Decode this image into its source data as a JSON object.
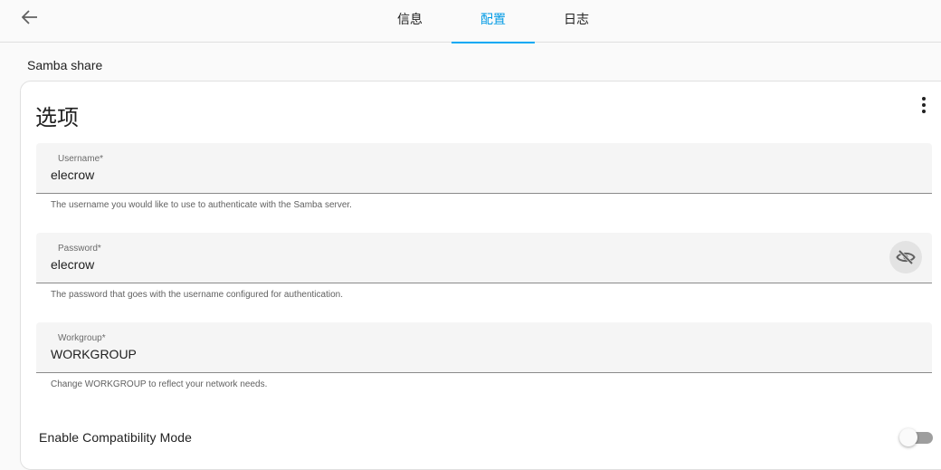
{
  "header": {
    "back_icon": "arrow-left-icon",
    "tabs": [
      {
        "label": "信息",
        "active": false
      },
      {
        "label": "配置",
        "active": true
      },
      {
        "label": "日志",
        "active": false
      }
    ],
    "accent_color": "#03a9f4"
  },
  "section": {
    "title": "Samba share"
  },
  "card": {
    "title": "选项",
    "menu_icon": "more-vertical-icon",
    "fields": [
      {
        "label": "Username*",
        "value": "elecrow",
        "helper": "The username you would like to use to authenticate with the Samba server."
      },
      {
        "label": "Password*",
        "value": "elecrow",
        "helper": "The password that goes with the username configured for authentication.",
        "icon": "eye-off-icon"
      },
      {
        "label": "Workgroup*",
        "value": "WORKGROUP",
        "helper": "Change WORKGROUP to reflect your network needs."
      }
    ],
    "compatibility": {
      "label": "Enable Compatibility Mode",
      "enabled": false
    }
  }
}
